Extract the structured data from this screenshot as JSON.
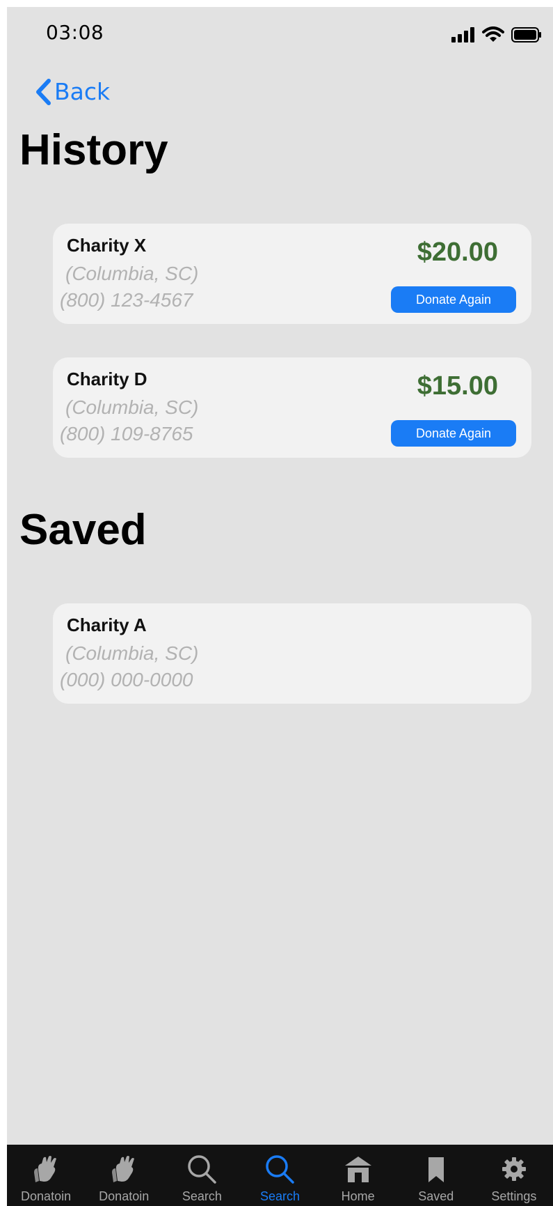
{
  "status_bar": {
    "time": "03:08"
  },
  "nav": {
    "back_label": "Back"
  },
  "history": {
    "title": "History",
    "items": [
      {
        "name": "Charity X",
        "location": "(Columbia, SC)",
        "phone": "(800) 123-4567",
        "amount": "$20.00",
        "button_label": "Donate Again"
      },
      {
        "name": "Charity D",
        "location": "(Columbia, SC)",
        "phone": "(800) 109-8765",
        "amount": "$15.00",
        "button_label": "Donate Again"
      }
    ]
  },
  "saved": {
    "title": "Saved",
    "items": [
      {
        "name": "Charity A",
        "location": "(Columbia, SC)",
        "phone": "(000) 000-0000"
      }
    ]
  },
  "tab_bar": {
    "items": [
      {
        "label": "Donatoin",
        "icon": "hands-icon",
        "active": false
      },
      {
        "label": "Donatoin",
        "icon": "hands-icon",
        "active": false
      },
      {
        "label": "Search",
        "icon": "search-icon",
        "active": false
      },
      {
        "label": "Search",
        "icon": "search-icon",
        "active": true
      },
      {
        "label": "Home",
        "icon": "home-icon",
        "active": false
      },
      {
        "label": "Saved",
        "icon": "bookmark-icon",
        "active": false
      },
      {
        "label": "Settings",
        "icon": "gear-icon",
        "active": false
      }
    ]
  },
  "colors": {
    "accent": "#1a7cf5",
    "amount": "#3e6e34",
    "background": "#e2e2e2",
    "card": "#f2f2f2",
    "tabbar": "#121212"
  }
}
